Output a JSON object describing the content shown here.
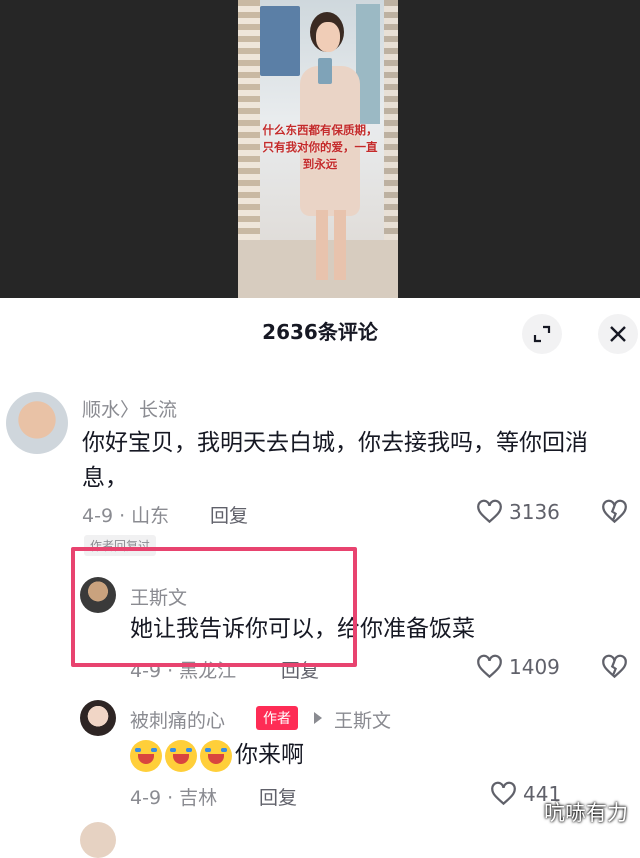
{
  "video": {
    "caption": "什么东西都有保质期，只有我对你的爱，一直到永远"
  },
  "panel": {
    "title": "2636条评论",
    "expand_icon": "expand-icon",
    "close_icon": "close-icon"
  },
  "comments": [
    {
      "name": "顺水〉长流",
      "text": "你好宝贝，我明天去白城，你去接我吗，等你回消息，",
      "meta": "4-9 · 山东",
      "reply_label": "回复",
      "likes": "3136",
      "author_tag": "作者回复过"
    },
    {
      "name": "王斯文",
      "text": "她让我告诉你可以，给你准备饭菜",
      "meta": "4-9 · 黑龙江",
      "reply_label": "回复",
      "likes": "1409"
    },
    {
      "name": "被刺痛的心",
      "badge": "作者",
      "reply_to": "王斯文",
      "text": "你来啊",
      "meta": "4-9 · 吉林",
      "reply_label": "回复",
      "likes": "441"
    }
  ],
  "watermark": "吭哧有力",
  "colors": {
    "accent": "#fe2c55",
    "highlight": "#e8436f"
  }
}
